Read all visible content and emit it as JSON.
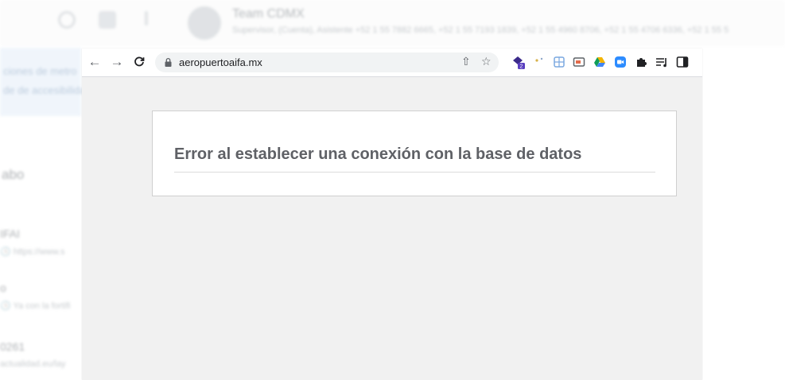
{
  "background_app": {
    "title": "Team CDMX",
    "subtitle": "Supervisor, (Cuenta), Asistente +52 1 55 7882 6665, +52 1 55 7193 1839, +52 1 55 4960 8706, +52 1 55 4706 6336, +52 1 55 5",
    "side_text": [
      "ciones de metro",
      "de de accesibilidad",
      "abo",
      "IFAI",
      "🕓 https://www.s",
      "o",
      "🕓 Ya con la fortifi",
      "0261",
      "actualidad.eu/lay"
    ]
  },
  "browser": {
    "url": "aeropuertoaifa.mx",
    "extension_badge": "2"
  },
  "page": {
    "error_message": "Error al establecer una conexión con la base de datos"
  },
  "colors": {
    "toolbar": "#ffffff",
    "omnibox": "#f1f3f4",
    "page_background": "#f1f1f1",
    "error_text": "#5f6166"
  }
}
